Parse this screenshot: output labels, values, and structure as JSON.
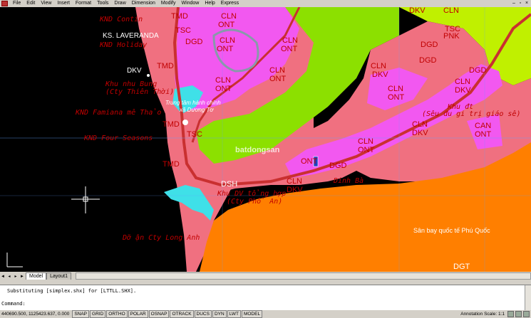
{
  "menu": [
    "File",
    "Edit",
    "View",
    "Insert",
    "Format",
    "Tools",
    "Draw",
    "Dimension",
    "Modify",
    "Window",
    "Help",
    "Express"
  ],
  "map_labels": {
    "ks_laveranda": "KS. LAVERANDA",
    "dkv_left": "DKV",
    "kn_contin": "KND Contin",
    "knd_hotel": "KND Holiday",
    "khu_nghi_duong": "Khu nhu Bung",
    "cty_thien_tho": "(Cty Thiên Thời)",
    "knd_famiana": "KND Famiana mê Thảo",
    "knd_four_seasons": "KND Four Seasons",
    "trung_tam": "Trung tâm hành chính",
    "xa_duong_to": "xã Dương Tơ",
    "tmd1": "TMD",
    "tmd2": "TMD",
    "tmd3": "TMD",
    "tmd4": "TMD",
    "tsc1": "TSC",
    "tsc2": "TSC",
    "tsc3": "TSC",
    "dgd1": "DGD",
    "dgd2": "DGD",
    "dgd3": "DGD",
    "dgd4": "DGD",
    "dsh": "DSH",
    "khu_dv": "Khu DV tổng hợp",
    "cty_pho_an": "(Cty Phổ An)",
    "dat_rung": "Dỡ ận Cty Long Anh",
    "san_bay": "Sân bay quốc tế Phú Quốc",
    "dgt": "DGT",
    "dinh_ba": "Dinh Bà",
    "pnk": "PNK",
    "can_ont": "CAN",
    "khu_dt": "Khu đt",
    "sieu_du_lich": "(Sêu đu gi trị giáo sê)",
    "cln": "CLN",
    "ont": "ONT",
    "dkv": "DKV",
    "watermark": "batdongsan"
  },
  "tabs": [
    "Model",
    "Layout1"
  ],
  "command": {
    "history": "Substituting [simplex.shx] for [LTTLL.SHX].",
    "prompt": "Command:"
  },
  "status": {
    "coords": "440690.500, 1125423.637, 0.000",
    "toggles": [
      "SNAP",
      "GRID",
      "ORTHO",
      "POLAR",
      "OSNAP",
      "OTRACK",
      "DUCS",
      "DYN",
      "LWT",
      "MODEL"
    ],
    "annotation_scale": "Annotation Scale: 1:1"
  }
}
